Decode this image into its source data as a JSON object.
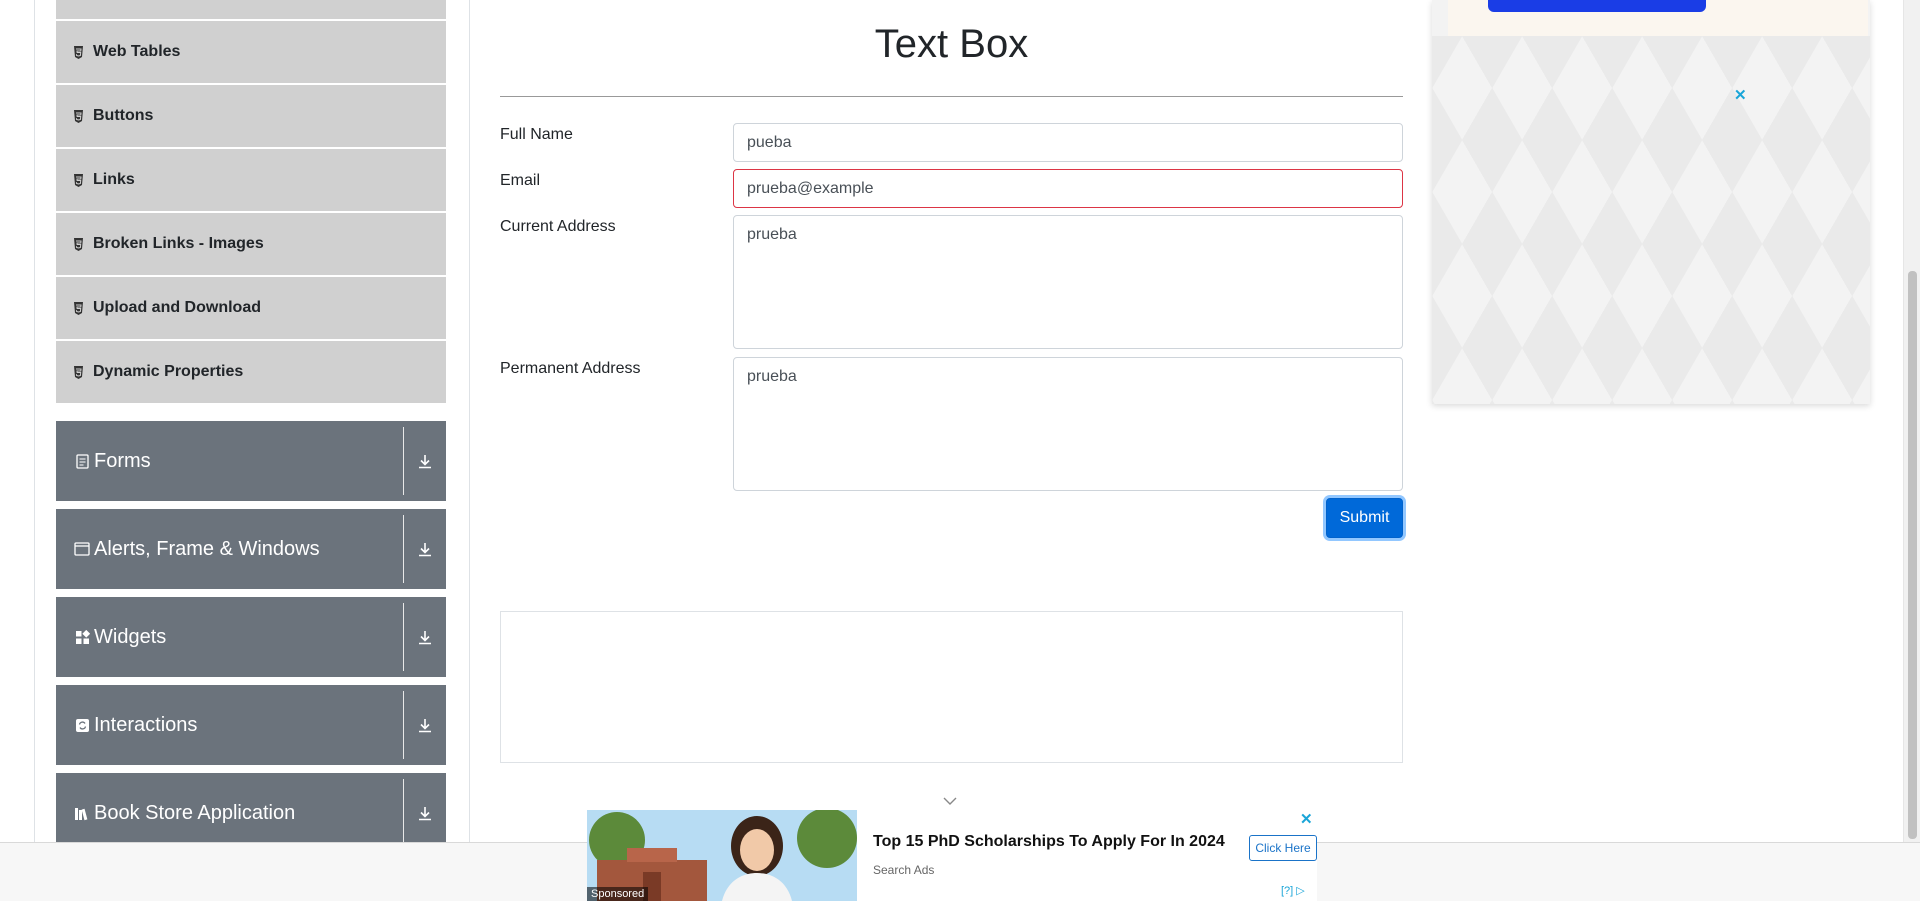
{
  "sidebar": {
    "elements_items": [
      {
        "label": "Web Tables"
      },
      {
        "label": "Buttons"
      },
      {
        "label": "Links"
      },
      {
        "label": "Broken Links - Images"
      },
      {
        "label": "Upload and Download"
      },
      {
        "label": "Dynamic Properties"
      }
    ],
    "groups": [
      {
        "label": "Forms"
      },
      {
        "label": "Alerts, Frame & Windows"
      },
      {
        "label": "Widgets"
      },
      {
        "label": "Interactions"
      },
      {
        "label": "Book Store Application"
      }
    ]
  },
  "main": {
    "title": "Text Box",
    "form": {
      "full_name_label": "Full Name",
      "full_name_value": "pueba",
      "email_label": "Email",
      "email_value": "prueba@example",
      "current_address_label": "Current Address",
      "current_address_value": "prueba",
      "permanent_address_label": "Permanent Address",
      "permanent_address_value": "prueba",
      "submit_label": "Submit"
    }
  },
  "bottom_ad": {
    "headline": "Top 15 PhD Scholarships To Apply For In 2024",
    "source": "Search Ads",
    "cta": "Click Here",
    "sponsored": "Sponsored",
    "close": "✕",
    "info": "[?]"
  },
  "right_ad": {
    "close": "✕"
  },
  "colors": {
    "sidebar_item_bg": "#d0d0d0",
    "group_bg": "#6b737c",
    "submit_bg": "#0069d9",
    "error_border": "#dc3545"
  }
}
